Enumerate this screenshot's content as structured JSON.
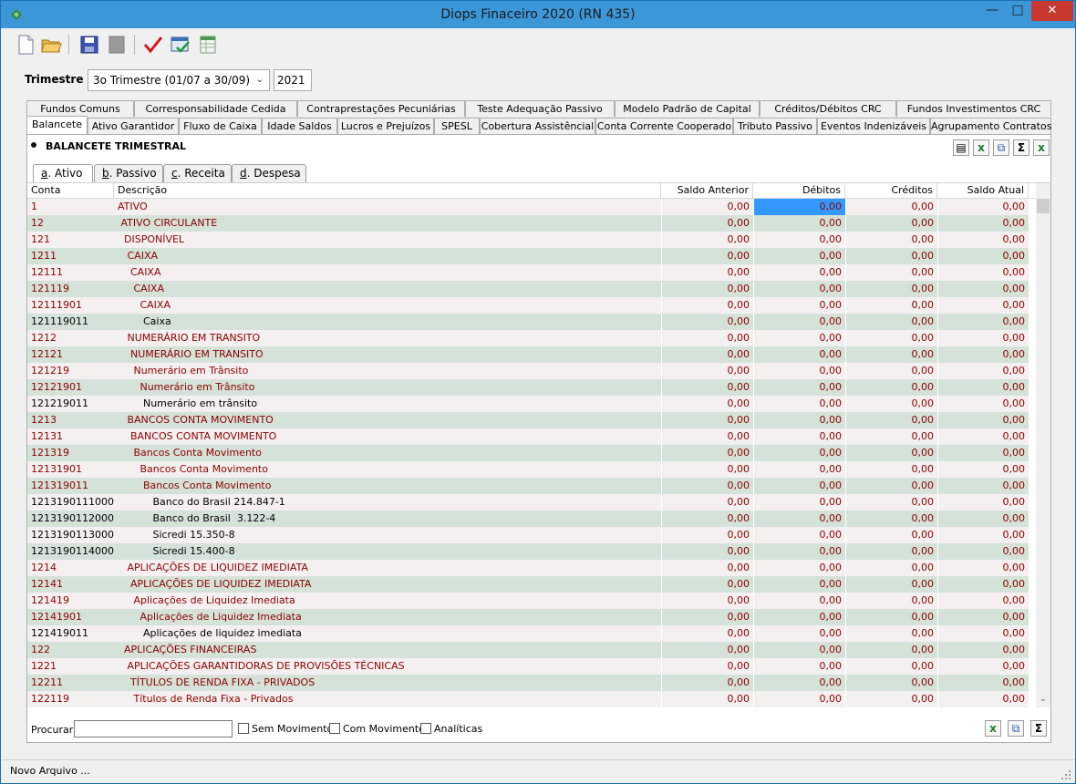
{
  "window": {
    "title": "Diops Finaceiro 2020 (RN 435)"
  },
  "trimestre": {
    "label": "Trimestre",
    "selected": "3o Trimestre (01/07 a 30/09)",
    "year": "2021"
  },
  "tabs_row1": [
    {
      "label": "Fundos Comuns"
    },
    {
      "label": "Corresponsabilidade Cedida"
    },
    {
      "label": "Contraprestações Pecuniárias"
    },
    {
      "label": "Teste Adequação Passivo"
    },
    {
      "label": "Modelo Padrão de Capital"
    },
    {
      "label": "Créditos/Débitos CRC"
    },
    {
      "label": "Fundos Investimentos CRC"
    }
  ],
  "tabs_row2": [
    {
      "label": "Balancete"
    },
    {
      "label": "Ativo Garantidor"
    },
    {
      "label": "Fluxo de Caixa"
    },
    {
      "label": "Idade Saldos"
    },
    {
      "label": "Lucros e Prejuízos"
    },
    {
      "label": "SPESL"
    },
    {
      "label": "Cobertura Assistêncial"
    },
    {
      "label": "Conta Corrente Cooperado"
    },
    {
      "label": "Tributo Passivo"
    },
    {
      "label": "Eventos Indenizáveis"
    },
    {
      "label": "Agrupamento Contratos"
    }
  ],
  "panel": {
    "title": "BALANCETE TRIMESTRAL"
  },
  "subtabs": [
    {
      "key": "a",
      "rest": ". Ativo"
    },
    {
      "key": "b",
      "rest": ". Passivo"
    },
    {
      "key": "c",
      "rest": ". Receita"
    },
    {
      "key": "d",
      "rest": ". Despesa"
    }
  ],
  "grid": {
    "headers": {
      "conta": "Conta",
      "desc": "Descrição",
      "sa": "Saldo Anterior",
      "deb": "Débitos",
      "cre": "Créditos",
      "sat": "Saldo Atual"
    },
    "rows": [
      {
        "conta": "1",
        "desc": "ATIVO",
        "v": [
          "0,00",
          "0,00",
          "0,00",
          "0,00"
        ]
      },
      {
        "conta": "12",
        "desc": " ATIVO CIRCULANTE",
        "v": [
          "0,00",
          "0,00",
          "0,00",
          "0,00"
        ]
      },
      {
        "conta": "121",
        "desc": "  DISPONÍVEL",
        "v": [
          "0,00",
          "0,00",
          "0,00",
          "0,00"
        ]
      },
      {
        "conta": "1211",
        "desc": "   CAIXA",
        "v": [
          "0,00",
          "0,00",
          "0,00",
          "0,00"
        ]
      },
      {
        "conta": "12111",
        "desc": "    CAIXA",
        "v": [
          "0,00",
          "0,00",
          "0,00",
          "0,00"
        ]
      },
      {
        "conta": "121119",
        "desc": "     CAIXA",
        "v": [
          "0,00",
          "0,00",
          "0,00",
          "0,00"
        ]
      },
      {
        "conta": "12111901",
        "desc": "       CAIXA",
        "v": [
          "0,00",
          "0,00",
          "0,00",
          "0,00"
        ]
      },
      {
        "conta": "121119011",
        "desc": "        Caixa",
        "v": [
          "0,00",
          "0,00",
          "0,00",
          "0,00"
        ]
      },
      {
        "conta": "1212",
        "desc": "   NUMERÁRIO EM TRANSITO",
        "v": [
          "0,00",
          "0,00",
          "0,00",
          "0,00"
        ]
      },
      {
        "conta": "12121",
        "desc": "    NUMERÁRIO EM TRANSITO",
        "v": [
          "0,00",
          "0,00",
          "0,00",
          "0,00"
        ]
      },
      {
        "conta": "121219",
        "desc": "     Numerário em Trânsito",
        "v": [
          "0,00",
          "0,00",
          "0,00",
          "0,00"
        ]
      },
      {
        "conta": "12121901",
        "desc": "       Numerário em Trânsito",
        "v": [
          "0,00",
          "0,00",
          "0,00",
          "0,00"
        ]
      },
      {
        "conta": "121219011",
        "desc": "        Numerário em trânsito",
        "v": [
          "0,00",
          "0,00",
          "0,00",
          "0,00"
        ]
      },
      {
        "conta": "1213",
        "desc": "   BANCOS CONTA MOVIMENTO",
        "v": [
          "0,00",
          "0,00",
          "0,00",
          "0,00"
        ]
      },
      {
        "conta": "12131",
        "desc": "    BANCOS CONTA MOVIMENTO",
        "v": [
          "0,00",
          "0,00",
          "0,00",
          "0,00"
        ]
      },
      {
        "conta": "121319",
        "desc": "     Bancos Conta Movimento",
        "v": [
          "0,00",
          "0,00",
          "0,00",
          "0,00"
        ]
      },
      {
        "conta": "12131901",
        "desc": "       Bancos Conta Movimento",
        "v": [
          "0,00",
          "0,00",
          "0,00",
          "0,00"
        ]
      },
      {
        "conta": "121319011",
        "desc": "        Bancos Conta Movimento",
        "v": [
          "0,00",
          "0,00",
          "0,00",
          "0,00"
        ]
      },
      {
        "conta": "1213190111000",
        "desc": "           Banco do Brasil 214.847-1",
        "v": [
          "0,00",
          "0,00",
          "0,00",
          "0,00"
        ]
      },
      {
        "conta": "1213190112000",
        "desc": "           Banco do Brasil  3.122-4",
        "v": [
          "0,00",
          "0,00",
          "0,00",
          "0,00"
        ]
      },
      {
        "conta": "1213190113000",
        "desc": "           Sicredi 15.350-8",
        "v": [
          "0,00",
          "0,00",
          "0,00",
          "0,00"
        ]
      },
      {
        "conta": "1213190114000",
        "desc": "           Sicredi 15.400-8",
        "v": [
          "0,00",
          "0,00",
          "0,00",
          "0,00"
        ]
      },
      {
        "conta": "1214",
        "desc": "   APLICAÇÕES DE LIQUIDEZ IMEDIATA",
        "v": [
          "0,00",
          "0,00",
          "0,00",
          "0,00"
        ]
      },
      {
        "conta": "12141",
        "desc": "    APLICAÇÕES DE LIQUIDEZ IMEDIATA",
        "v": [
          "0,00",
          "0,00",
          "0,00",
          "0,00"
        ]
      },
      {
        "conta": "121419",
        "desc": "     Aplicações de Liquidez Imediata",
        "v": [
          "0,00",
          "0,00",
          "0,00",
          "0,00"
        ]
      },
      {
        "conta": "12141901",
        "desc": "       Aplicações de Liquidez Imediata",
        "v": [
          "0,00",
          "0,00",
          "0,00",
          "0,00"
        ]
      },
      {
        "conta": "121419011",
        "desc": "        Aplicações de liquidez imediata",
        "v": [
          "0,00",
          "0,00",
          "0,00",
          "0,00"
        ]
      },
      {
        "conta": "122",
        "desc": "  APLICAÇÕES FINANCEIRAS",
        "v": [
          "0,00",
          "0,00",
          "0,00",
          "0,00"
        ]
      },
      {
        "conta": "1221",
        "desc": "   APLICAÇÕES GARANTIDORAS DE PROVISÕES TÉCNICAS",
        "v": [
          "0,00",
          "0,00",
          "0,00",
          "0,00"
        ]
      },
      {
        "conta": "12211",
        "desc": "    TÍTULOS DE RENDA FIXA - PRIVADOS",
        "v": [
          "0,00",
          "0,00",
          "0,00",
          "0,00"
        ]
      },
      {
        "conta": "122119",
        "desc": "     Títulos de Renda Fixa - Privados",
        "v": [
          "0,00",
          "0,00",
          "0,00",
          "0,00"
        ]
      }
    ]
  },
  "search": {
    "label": "Procurar",
    "value": "",
    "sem_movimento": "Sem Movimento",
    "com_movimento": "Com Movimento",
    "analiticas": "Analíticas"
  },
  "status": {
    "text": "Novo Arquivo ..."
  },
  "colors": {
    "accent": "#3c97d8",
    "row_green": "#d5e2d8",
    "row_light": "#f4f0f0",
    "text_red": "#8b0000",
    "selection": "#3399ff"
  }
}
